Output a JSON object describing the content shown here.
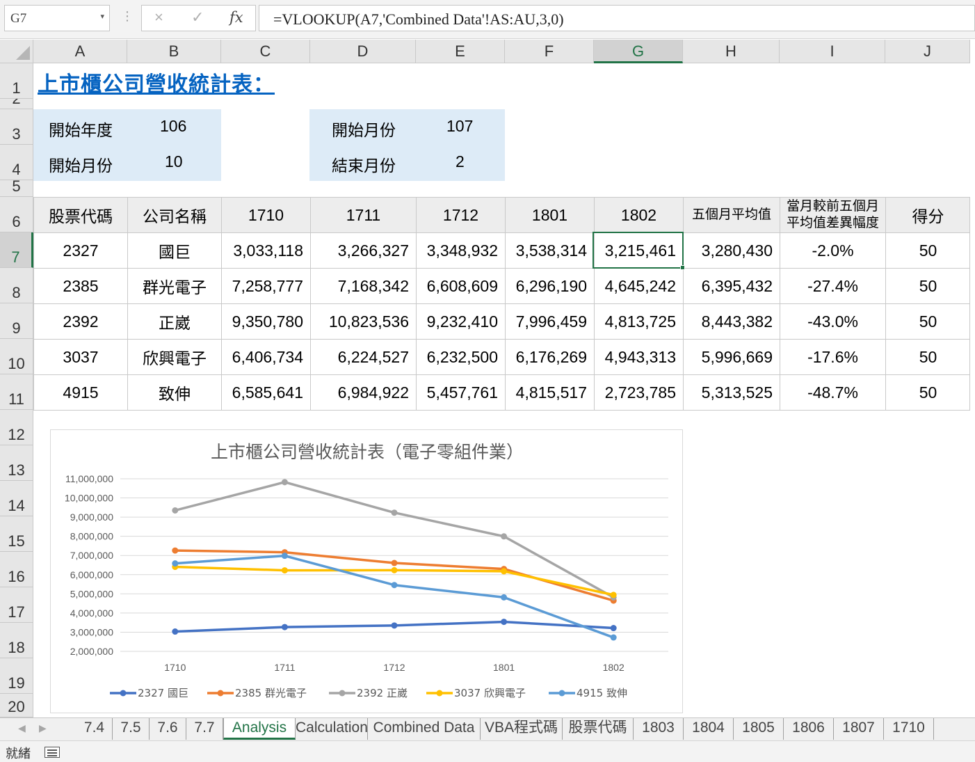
{
  "formula_bar": {
    "name_box": "G7",
    "cancel_icon": "×",
    "enter_icon": "✓",
    "fx_label": "fx",
    "formula": "=VLOOKUP(A7,'Combined Data'!AS:AU,3,0)"
  },
  "columns": [
    "A",
    "B",
    "C",
    "D",
    "E",
    "F",
    "G",
    "H",
    "I",
    "J"
  ],
  "selected_column": "G",
  "rows": [
    "1",
    "2",
    "3",
    "4",
    "5",
    "6",
    "7",
    "8",
    "9",
    "10",
    "11",
    "12",
    "13",
    "14",
    "15",
    "16",
    "17",
    "18",
    "19",
    "20"
  ],
  "selected_row": "7",
  "sheet": {
    "title": "上市櫃公司營收統計表：",
    "params_left": [
      {
        "label": "開始年度",
        "value": "106"
      },
      {
        "label": "開始月份",
        "value": "10"
      }
    ],
    "params_right": [
      {
        "label": "開始月份",
        "value": "107"
      },
      {
        "label": "結束月份",
        "value": "2"
      }
    ]
  },
  "table": {
    "headers": [
      "股票代碼",
      "公司名稱",
      "1710",
      "1711",
      "1712",
      "1801",
      "1802",
      "五個月平均值",
      "當月較前五個月平均值差異幅度",
      "得分"
    ],
    "rows": [
      [
        "2327",
        "國巨",
        "3,033,118",
        "3,266,327",
        "3,348,932",
        "3,538,314",
        "3,215,461",
        "3,280,430",
        "-2.0%",
        "50"
      ],
      [
        "2385",
        "群光電子",
        "7,258,777",
        "7,168,342",
        "6,608,609",
        "6,296,190",
        "4,645,242",
        "6,395,432",
        "-27.4%",
        "50"
      ],
      [
        "2392",
        "正崴",
        "9,350,780",
        "10,823,536",
        "9,232,410",
        "7,996,459",
        "4,813,725",
        "8,443,382",
        "-43.0%",
        "50"
      ],
      [
        "3037",
        "欣興電子",
        "6,406,734",
        "6,224,527",
        "6,232,500",
        "6,176,269",
        "4,943,313",
        "5,996,669",
        "-17.6%",
        "50"
      ],
      [
        "4915",
        "致伸",
        "6,585,641",
        "6,984,922",
        "5,457,761",
        "4,815,517",
        "2,723,785",
        "5,313,525",
        "-48.7%",
        "50"
      ]
    ]
  },
  "chart_data": {
    "type": "line",
    "title": "上市櫃公司營收統計表（電子零組件業）",
    "categories": [
      "1710",
      "1711",
      "1712",
      "1801",
      "1802"
    ],
    "ylim": [
      2000000,
      11000000
    ],
    "yticks": [
      "11,000,000",
      "10,000,000",
      "9,000,000",
      "8,000,000",
      "7,000,000",
      "6,000,000",
      "5,000,000",
      "4,000,000",
      "3,000,000",
      "2,000,000"
    ],
    "grid": true,
    "legend": "bottom",
    "series": [
      {
        "name": "2327 國巨",
        "color": "#4472c4",
        "values": [
          3033118,
          3266327,
          3348932,
          3538314,
          3215461
        ]
      },
      {
        "name": "2385 群光電子",
        "color": "#ed7d31",
        "values": [
          7258777,
          7168342,
          6608609,
          6296190,
          4645242
        ]
      },
      {
        "name": "2392 正崴",
        "color": "#a5a5a5",
        "values": [
          9350780,
          10823536,
          9232410,
          7996459,
          4813725
        ]
      },
      {
        "name": "3037 欣興電子",
        "color": "#ffc000",
        "values": [
          6406734,
          6224527,
          6232500,
          6176269,
          4943313
        ]
      },
      {
        "name": "4915 致伸",
        "color": "#5b9bd5",
        "values": [
          6585641,
          6984922,
          5457761,
          4815517,
          2723785
        ]
      }
    ]
  },
  "tabs": [
    "7.4",
    "7.5",
    "7.6",
    "7.7",
    "Analysis",
    "Calculation",
    "Combined Data",
    "VBA程式碼",
    "股票代碼",
    "1803",
    "1804",
    "1805",
    "1806",
    "1807",
    "1710"
  ],
  "active_tab": "Analysis",
  "status": {
    "text": "就緒"
  }
}
